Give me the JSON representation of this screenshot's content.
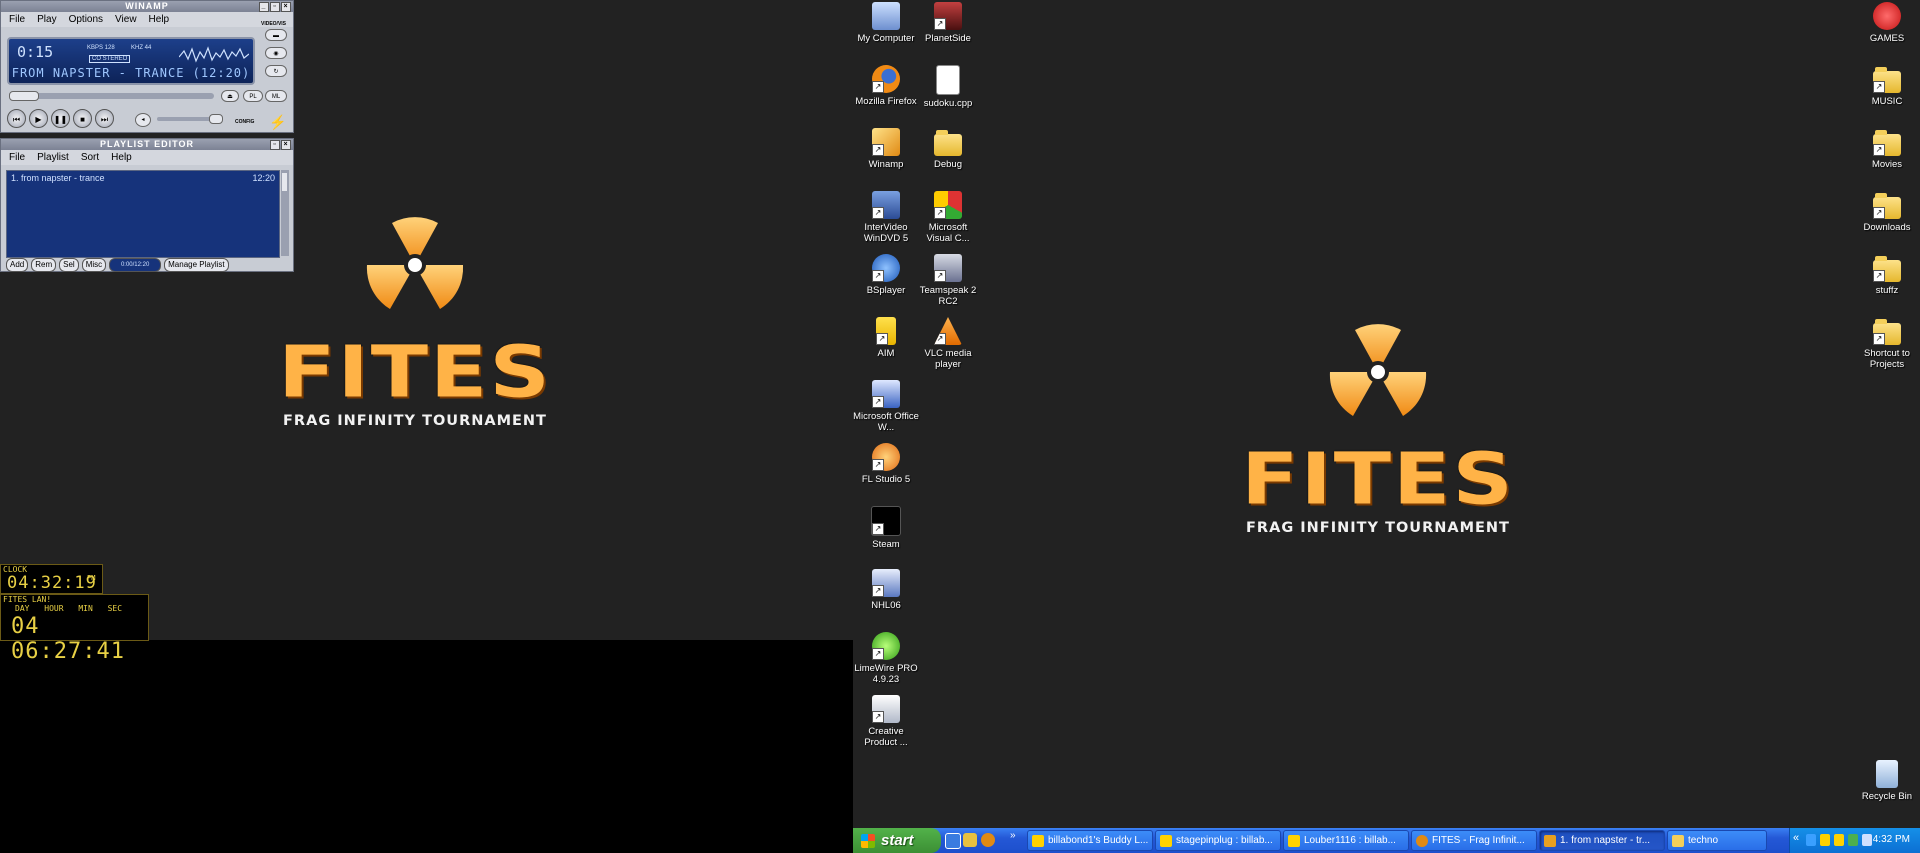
{
  "logo": {
    "wordmark": "FITES",
    "tagline": "FRAG INFINITY TOURNAMENT"
  },
  "winamp": {
    "title": "WINAMP",
    "menu": [
      "File",
      "Play",
      "Options",
      "View",
      "Help"
    ],
    "time": "0:15",
    "kbps_label": "KBPS 128",
    "khz_label": "KHZ 44",
    "stereo_label": "CO STEREO",
    "track_scroll": "FROM NAPSTER - TRANCE (12:20)",
    "side_label": "VIDEO/VIS",
    "config_label": "CONFIG",
    "controls": [
      "prev",
      "play",
      "pause",
      "stop",
      "next"
    ],
    "buttons": [
      "PL",
      "ML"
    ]
  },
  "playlist": {
    "title": "PLAYLIST EDITOR",
    "menu": [
      "File",
      "Playlist",
      "Sort",
      "Help"
    ],
    "items": [
      {
        "label": "1. from napster - trance",
        "duration": "12:20"
      }
    ],
    "buttons": [
      "Add",
      "Rem",
      "Sel",
      "Misc"
    ],
    "time_box": "0:00/12:20",
    "manage": "Manage Playlist"
  },
  "clock_widget": {
    "label": "CLOCK",
    "time": "04:32:19",
    "ampm": "PM"
  },
  "countdown_widget": {
    "label": "FITES LAN!",
    "headers": "DAY HOUR MIN SEC",
    "value": "04 06:27:41"
  },
  "desktop_icons": [
    "My Computer",
    "PlanetSide",
    "Mozilla Firefox",
    "sudoku.cpp",
    "Winamp",
    "Debug",
    "InterVideo WinDVD 5",
    "Microsoft Visual C...",
    "BSplayer",
    "Teamspeak 2 RC2",
    "AIM",
    "VLC media player",
    "Microsoft Office W...",
    "FL Studio 5",
    "Steam",
    "NHL06",
    "LimeWire PRO 4.9.23",
    "Creative Product ...",
    "GAMES",
    "MUSIC",
    "Movies",
    "Downloads",
    "stuffz",
    "Shortcut to Projects",
    "Recycle Bin"
  ],
  "taskbar": {
    "start": "start",
    "items": [
      "billabond1's Buddy L...",
      "stagepinplug : billab...",
      "Louber1116 : billab...",
      "FITES - Frag Infinit...",
      "1. from napster - tr...",
      "techno"
    ],
    "active_index": 4,
    "clock": "4:32 PM"
  },
  "colors": {
    "desktop": "#222222",
    "accent": "#ffb347",
    "taskbar": "#2458d6",
    "start": "#3c8f34"
  }
}
